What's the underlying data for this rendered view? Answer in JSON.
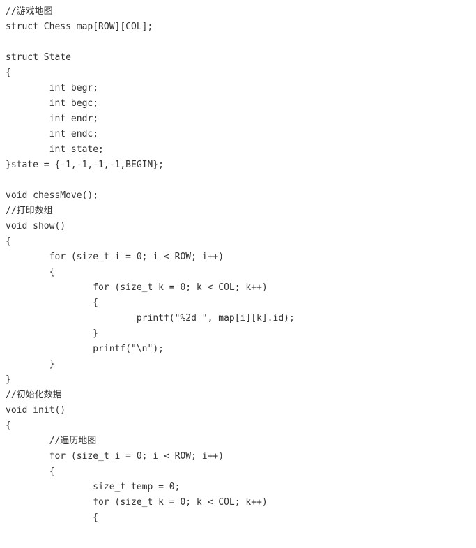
{
  "code": {
    "lines": [
      "//游戏地图",
      "struct Chess map[ROW][COL];",
      "",
      "struct State",
      "{",
      "        int begr;",
      "        int begc;",
      "        int endr;",
      "        int endc;",
      "        int state;",
      "}state = {-1,-1,-1,-1,BEGIN};",
      "",
      "void chessMove();",
      "//打印数组",
      "void show()",
      "{",
      "        for (size_t i = 0; i < ROW; i++)",
      "        {",
      "                for (size_t k = 0; k < COL; k++)",
      "                {",
      "                        printf(\"%2d \", map[i][k].id);",
      "                }",
      "                printf(\"\\n\");",
      "        }",
      "}",
      "//初始化数据",
      "void init()",
      "{",
      "        //遍历地图",
      "        for (size_t i = 0; i < ROW; i++)",
      "        {",
      "                size_t temp = 0;",
      "                for (size_t k = 0; k < COL; k++)",
      "                {"
    ]
  }
}
